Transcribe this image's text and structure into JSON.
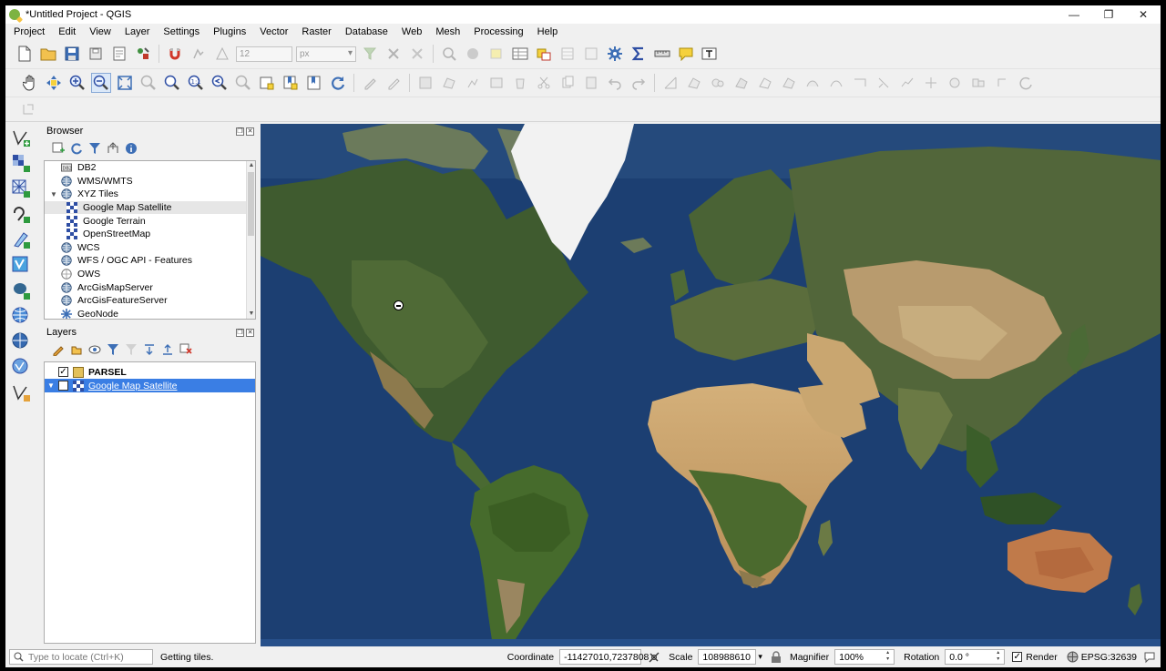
{
  "window": {
    "title": "*Untitled Project - QGIS",
    "controls": [
      "—",
      "❐",
      "✕"
    ]
  },
  "menu": [
    "Project",
    "Edit",
    "View",
    "Layer",
    "Settings",
    "Plugins",
    "Vector",
    "Raster",
    "Database",
    "Web",
    "Mesh",
    "Processing",
    "Help"
  ],
  "toolbar": {
    "font_size_value": "12",
    "unit_value": "px"
  },
  "browser": {
    "title": "Browser",
    "items": [
      {
        "label": "DB2",
        "icon": "db2-icon",
        "indent": 0
      },
      {
        "label": "WMS/WMTS",
        "icon": "globe-icon",
        "indent": 0
      },
      {
        "label": "XYZ Tiles",
        "icon": "globe-icon",
        "indent": 0,
        "expanded": true
      },
      {
        "label": "Google Map Satellite",
        "icon": "tile-icon",
        "indent": 1,
        "highlighted": true
      },
      {
        "label": "Google Terrain",
        "icon": "tile-icon",
        "indent": 1
      },
      {
        "label": "OpenStreetMap",
        "icon": "tile-icon",
        "indent": 1
      },
      {
        "label": "WCS",
        "icon": "globe-icon",
        "indent": 0
      },
      {
        "label": "WFS / OGC API - Features",
        "icon": "globe-icon",
        "indent": 0
      },
      {
        "label": "OWS",
        "icon": "globe-outline-icon",
        "indent": 0
      },
      {
        "label": "ArcGisMapServer",
        "icon": "globe-icon",
        "indent": 0
      },
      {
        "label": "ArcGisFeatureServer",
        "icon": "globe-icon",
        "indent": 0
      },
      {
        "label": "GeoNode",
        "icon": "geonode-icon",
        "indent": 0
      }
    ]
  },
  "layers": {
    "title": "Layers",
    "items": [
      {
        "label": "PARSEL",
        "checked": true,
        "bold": true,
        "selected": false
      },
      {
        "label": "Google Map Satellite",
        "checked": true,
        "bold": false,
        "selected": true
      }
    ]
  },
  "status": {
    "locator_placeholder": "Type to locate (Ctrl+K)",
    "message": "Getting tiles.",
    "coordinate_label": "Coordinate",
    "coordinate_value": "-11427010,7237808",
    "scale_label": "Scale",
    "scale_value": "108988610",
    "magnifier_label": "Magnifier",
    "magnifier_value": "100%",
    "rotation_label": "Rotation",
    "rotation_value": "0.0 °",
    "render_label": "Render",
    "crs": "EPSG:32639"
  },
  "colors": {
    "ocean": "#1c3f72",
    "land_green": "#3f5b2f",
    "desert": "#c9a36b",
    "ice": "#f2f2f2",
    "selection": "#3a7ee4"
  }
}
